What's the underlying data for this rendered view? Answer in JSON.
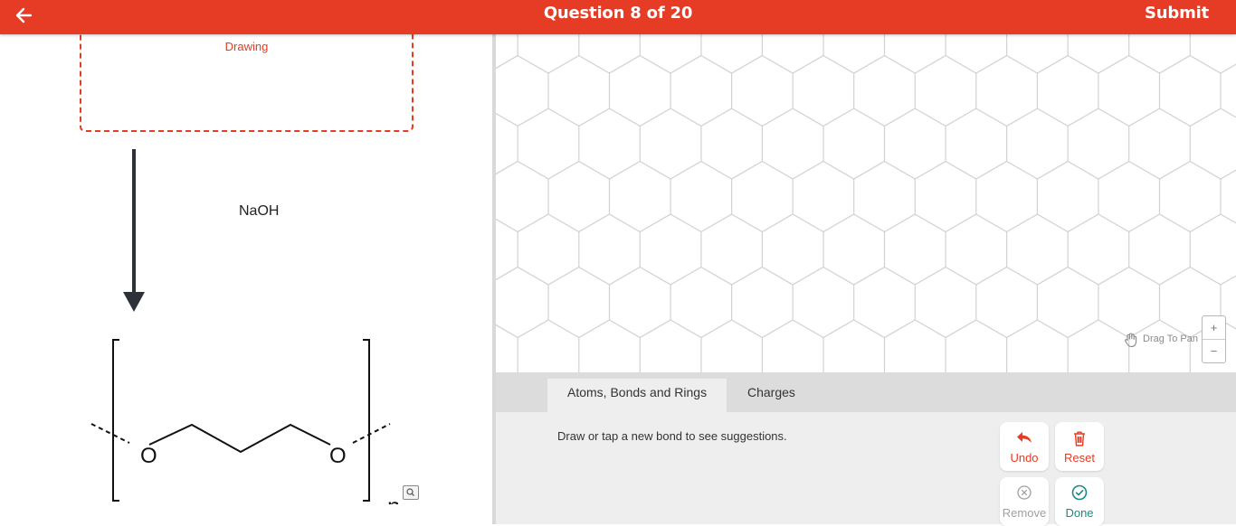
{
  "header": {
    "title": "Question 8 of 20",
    "submit_label": "Submit"
  },
  "reaction": {
    "drawing_label": "Drawing",
    "reagent": "NaOH",
    "product_atoms": {
      "oxygen_left": "O",
      "oxygen_right": "O",
      "subscript": "n"
    }
  },
  "canvas": {
    "pan_hint": "Drag To Pan",
    "zoom_in": "+",
    "zoom_out": "−"
  },
  "tools": {
    "tabs": [
      {
        "label": "Atoms, Bonds and Rings",
        "active": true
      },
      {
        "label": "Charges",
        "active": false
      }
    ],
    "hint": "Draw or tap a new bond to see suggestions.",
    "buttons": {
      "undo": "Undo",
      "reset": "Reset",
      "remove": "Remove",
      "done": "Done"
    }
  },
  "colors": {
    "brand": "#e63b25",
    "done": "#1a8a82",
    "disabled": "#a0a0a0"
  }
}
